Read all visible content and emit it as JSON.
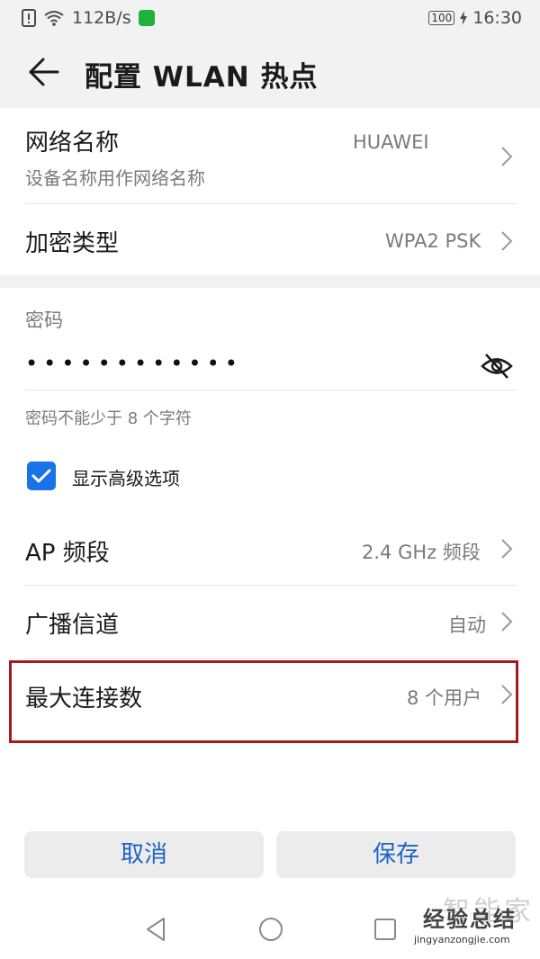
{
  "status_bar": {
    "net_speed": "112B/s",
    "battery": "100",
    "time": "16:30"
  },
  "app_bar": {
    "title": "配置 WLAN 热点"
  },
  "network_name": {
    "label": "网络名称",
    "subtitle": "设备名称用作网络名称",
    "value": "HUAWEI"
  },
  "encryption": {
    "label": "加密类型",
    "value": "WPA2 PSK"
  },
  "password": {
    "label": "密码",
    "masked_value": "••••••••••••",
    "hint": "密码不能少于 8 个字符"
  },
  "advanced": {
    "label": "显示高级选项",
    "checked": true
  },
  "ap_band": {
    "label": "AP 频段",
    "value": "2.4 GHz 频段"
  },
  "channel": {
    "label": "广播信道",
    "value": "自动"
  },
  "max_connections": {
    "label": "最大连接数",
    "value": "8 个用户"
  },
  "buttons": {
    "cancel": "取消",
    "save": "保存"
  },
  "watermark": {
    "cn": "经验总结",
    "cn_bg": "智能家",
    "en": "jingyanzongjie.com"
  },
  "colors": {
    "accent": "#1a73e8",
    "button_text": "#1f63c5",
    "highlight_box": "#a51a1f"
  }
}
